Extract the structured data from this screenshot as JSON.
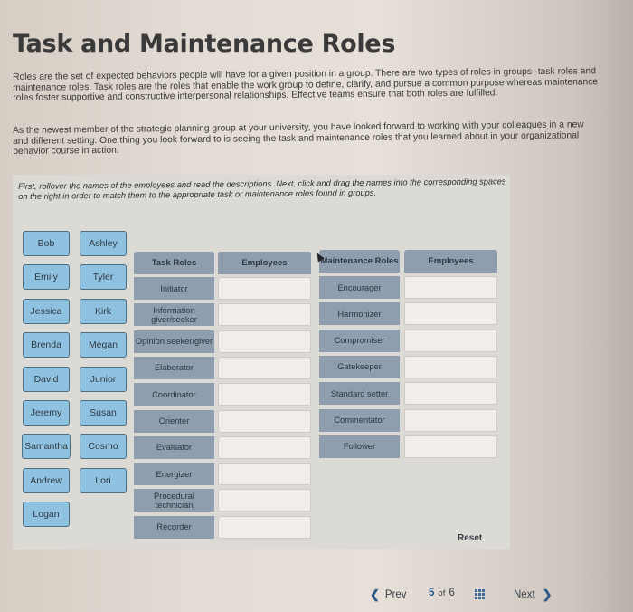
{
  "page": {
    "title": "Task and Maintenance Roles",
    "intro_paragraph": "Roles are the set of expected behaviors people will have for a given position in a group. There are two types of roles in groups--task roles and maintenance roles. Task roles are the roles that enable the work group to define, clarify, and pursue a common purpose whereas maintenance roles foster supportive and constructive interpersonal relationships. Effective teams ensure that both roles are fulfilled.",
    "scenario_paragraph": "As the newest member of the strategic planning group at your university, you have looked forward to working with your colleagues in a new and different setting. One thing you look forward to is seeing the task and maintenance roles that you learned about in your organizational behavior course in action."
  },
  "activity": {
    "instructions": "First, rollover the names of the employees and read the descriptions. Next, click and drag the names into the corresponding spaces on the right in order to match them to the appropriate task or maintenance roles found in groups.",
    "employees": [
      "Bob",
      "Ashley",
      "Emily",
      "Tyler",
      "Jessica",
      "Kirk",
      "Brenda",
      "Megan",
      "David",
      "Junior",
      "Jeremy",
      "Susan",
      "Samantha",
      "Cosmo",
      "Andrew",
      "Lori",
      "Logan"
    ],
    "task_table": {
      "role_header": "Task Roles",
      "employee_header": "Employees",
      "roles": [
        "Initiator",
        "Information giver/seeker",
        "Opinion seeker/giver",
        "Elaborator",
        "Coordinator",
        "Orienter",
        "Evaluator",
        "Energizer",
        "Procedural technician",
        "Recorder"
      ]
    },
    "maintenance_table": {
      "role_header": "Maintenance Roles",
      "employee_header": "Employees",
      "roles": [
        "Encourager",
        "Harmonizer",
        "Compromiser",
        "Gatekeeper",
        "Standard setter",
        "Commentator",
        "Follower"
      ]
    },
    "reset_label": "Reset"
  },
  "pagination": {
    "prev_label": "Prev",
    "current_page": "5",
    "of_label": "of",
    "total_pages": "6",
    "next_label": "Next"
  }
}
